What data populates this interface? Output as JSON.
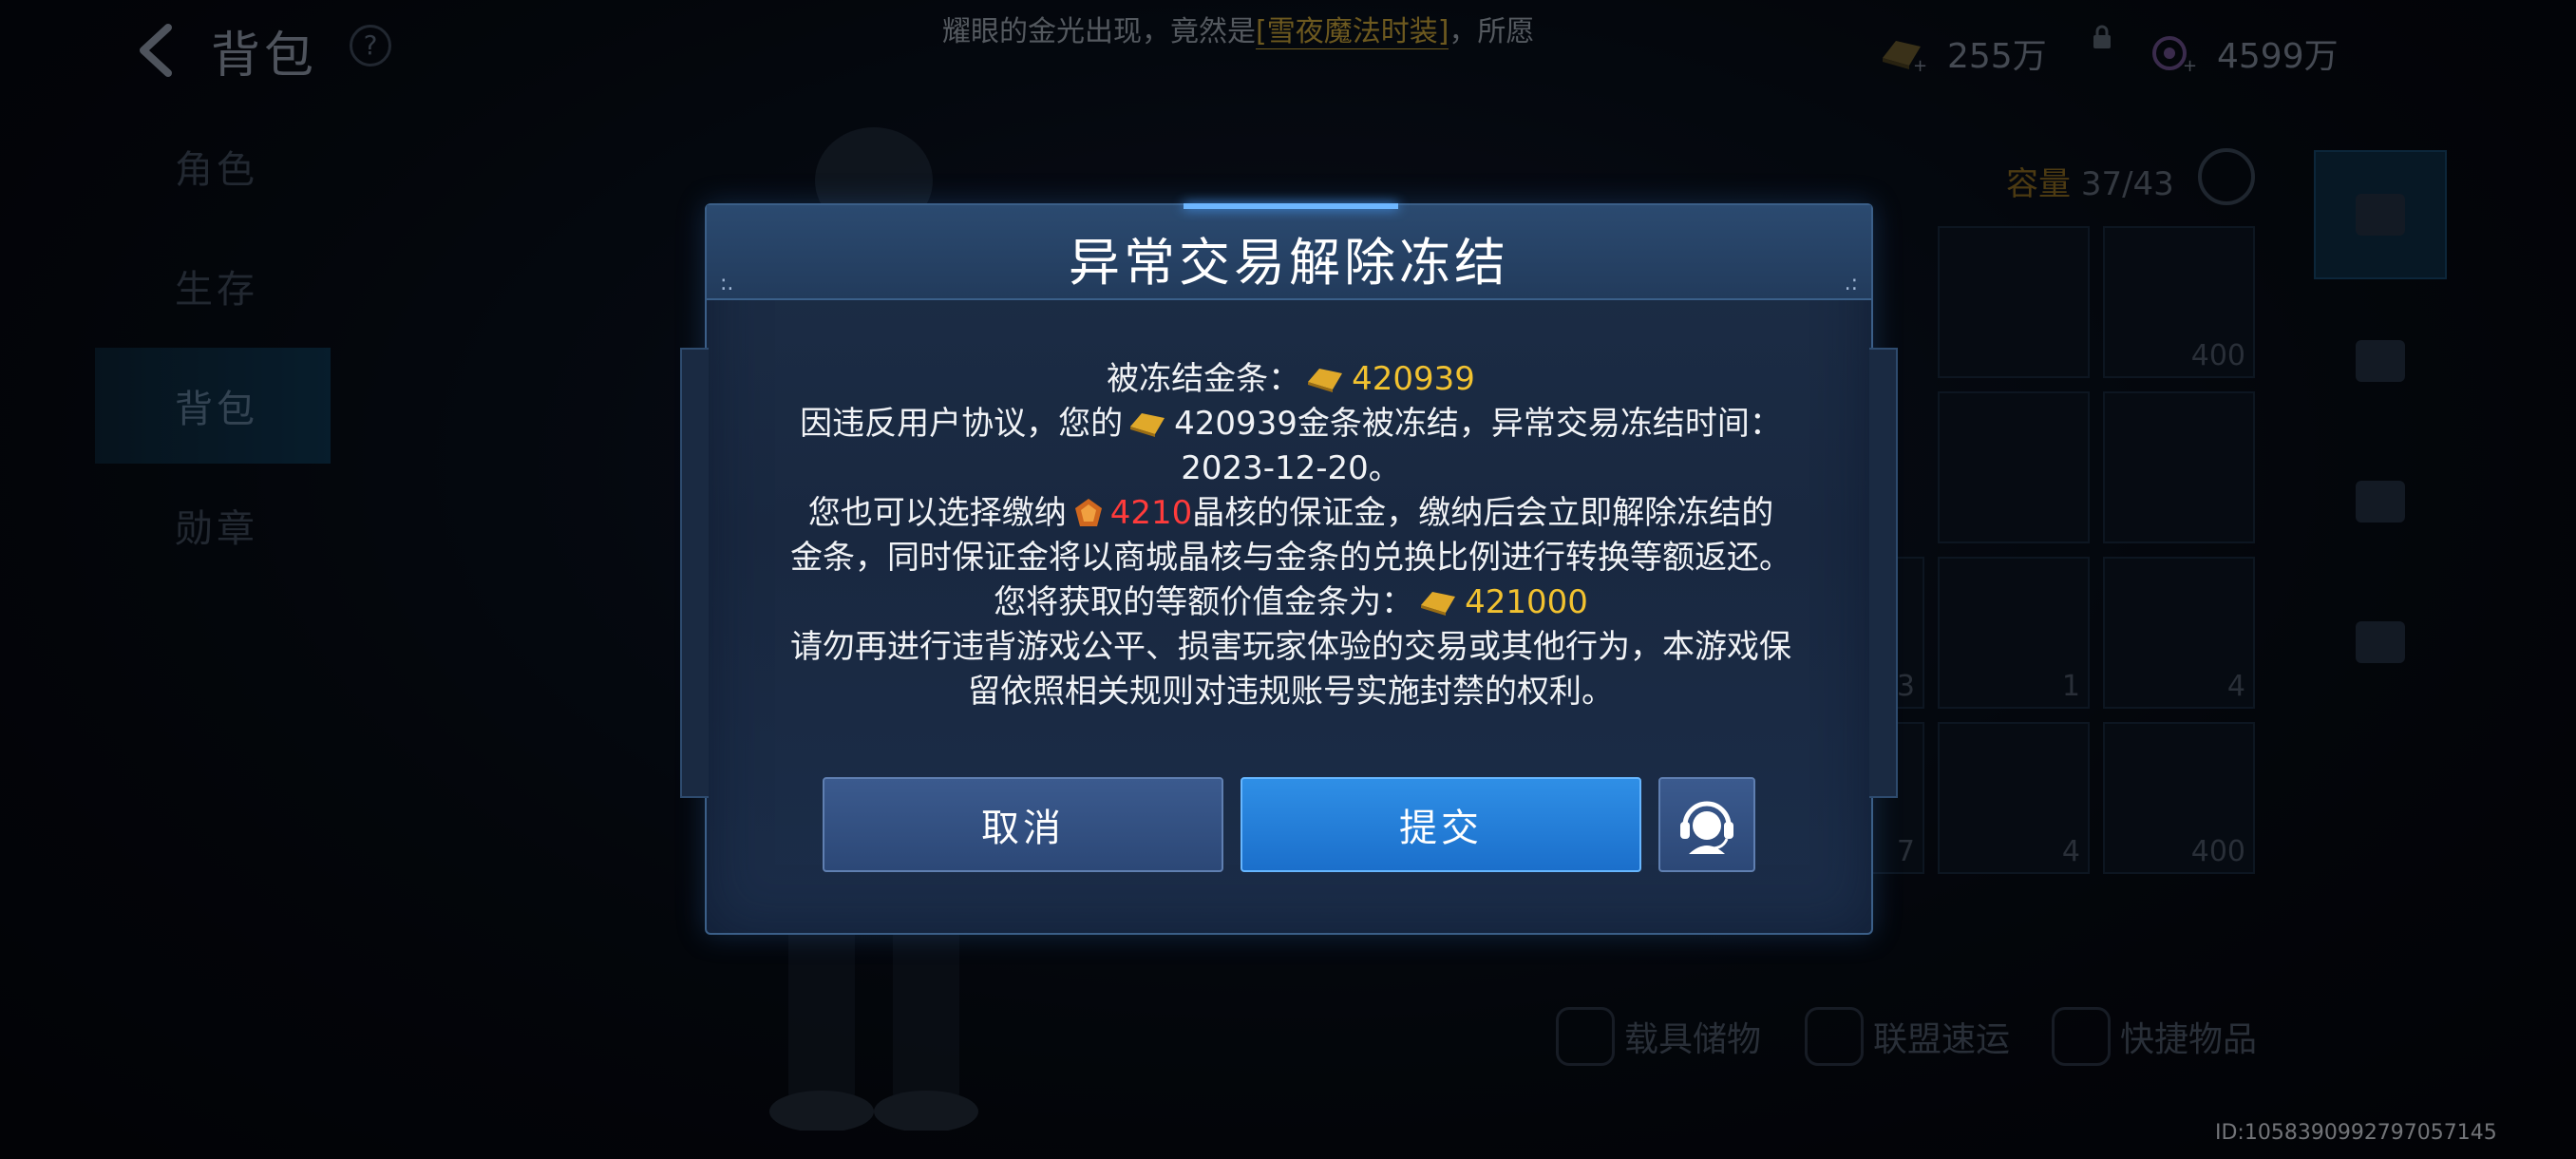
{
  "header": {
    "title": "背包",
    "help_label": "?",
    "ticker_before": "耀眼的金光出现，竟然是",
    "ticker_highlight": "[雪夜魔法时装]",
    "ticker_after": "，所愿",
    "currency_gold": "255万",
    "currency_crystal": "4599万"
  },
  "nav": {
    "items": [
      {
        "label": "角色"
      },
      {
        "label": "生存"
      },
      {
        "label": "背包"
      },
      {
        "label": "勋章"
      }
    ],
    "active": "背包"
  },
  "inventory": {
    "capacity_label": "容量",
    "capacity_value": "37/43",
    "slot_counts": [
      "400",
      "3",
      "1",
      "4",
      "7",
      "4",
      "400"
    ],
    "bottom_buttons": [
      "载具储物",
      "联盟速运",
      "快捷物品"
    ]
  },
  "footer": {
    "uid": "ID:1058390992797057145"
  },
  "dialog": {
    "title": "异常交易解除冻结",
    "frozen_label": "被冻结金条：",
    "frozen_amount": "420939",
    "line2_a": "因违反用户协议，您的",
    "line2_amount": "420939",
    "line2_b": "金条被冻结，异常交易冻结时间：",
    "line3": "2023-12-20。",
    "line4_a": "您也可以选择缴纳",
    "line4_amount": "4210",
    "line4_b": "晶核的保证金，缴纳后会立即解除冻结的",
    "line5": "金条，同时保证金将以商城晶核与金条的兑换比例进行转换等额返还。",
    "line6_a": "您将获取的等额价值金条为：",
    "line6_amount": "421000",
    "line7": "请勿再进行违背游戏公平、损害玩家体验的交易或其他行为，本游戏保",
    "line8": "留依照相关规则对违规账号实施封禁的权利。",
    "cancel_label": "取消",
    "submit_label": "提交",
    "colors": {
      "gold": "#f2c230",
      "red": "#ff3b3b",
      "submit": "#2f8fe6"
    }
  }
}
